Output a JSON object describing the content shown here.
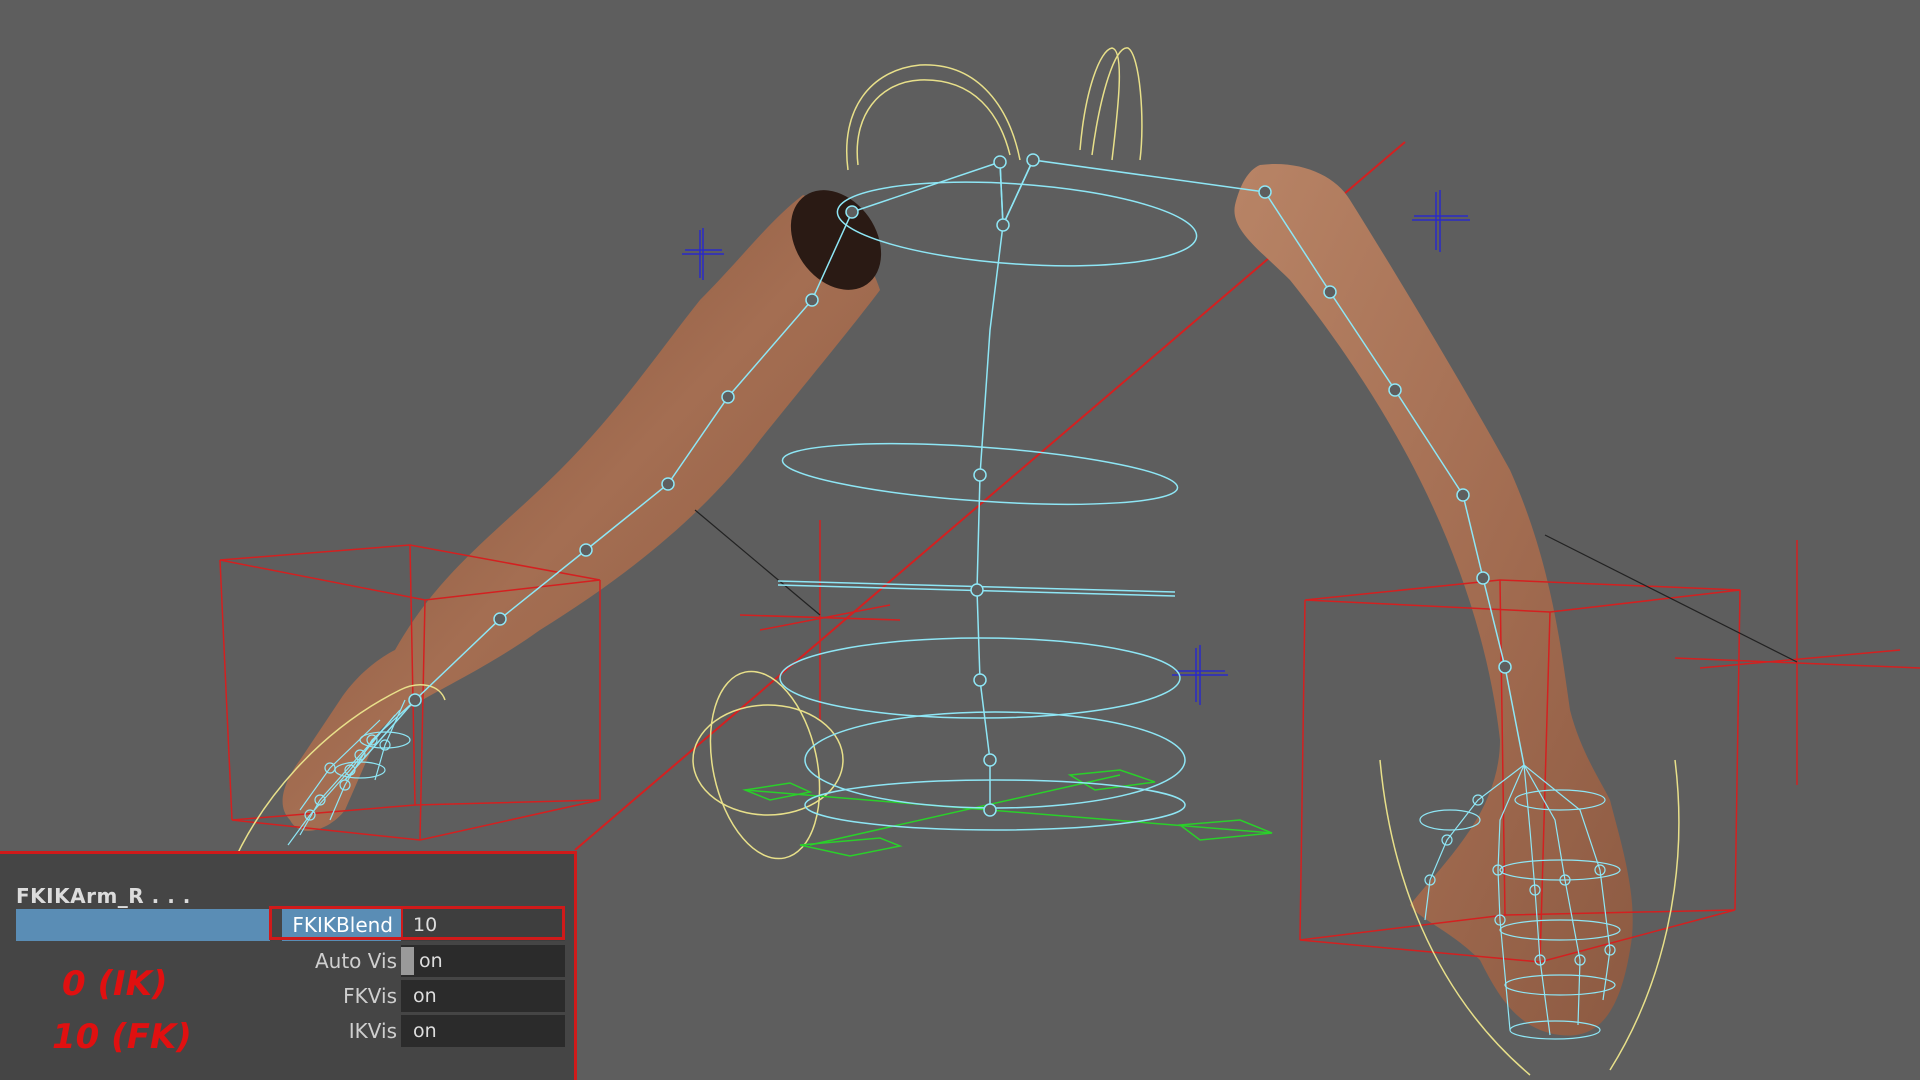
{
  "viewport": {
    "scene": "maya-arm-rig",
    "colors": {
      "background": "#5e5e5e",
      "joints": "#8ee6f5",
      "controls_red": "#d42020",
      "controls_yellow": "#e8e08a",
      "controls_green": "#2ad02a",
      "locators_blue": "#2a2ac8",
      "skin": "#a2694c"
    }
  },
  "channel_box": {
    "node_name": "FKIKArm_R . . .",
    "attributes": [
      {
        "label": "FKIKBlend",
        "value": "10"
      },
      {
        "label": "Auto Vis",
        "value": "on"
      },
      {
        "label": "FKVis",
        "value": "on"
      },
      {
        "label": "IKVis",
        "value": "on"
      }
    ]
  },
  "annotations": {
    "ik": "0 (IK)",
    "fk": "10 (FK)",
    "color": "#e01010"
  }
}
